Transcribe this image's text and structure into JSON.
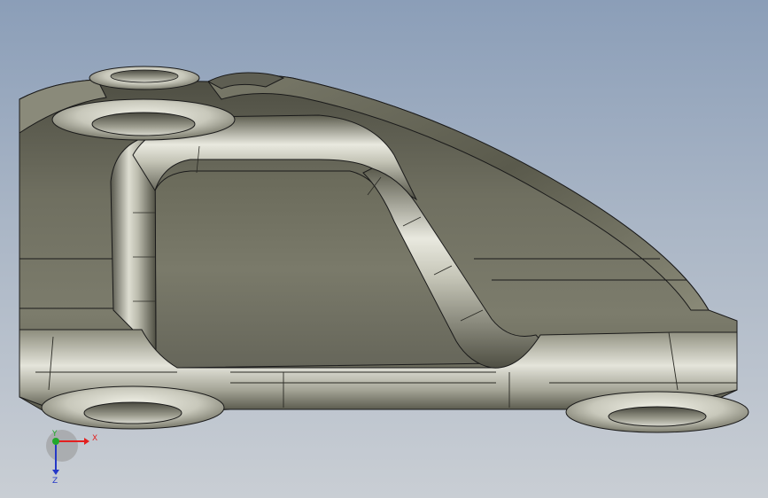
{
  "viewport": {
    "background_top": "#8b9eb8",
    "background_bottom": "#c9ced4",
    "model": {
      "body_color": "#6e6e5e",
      "highlight_color": "#e6e6dc",
      "edge_color": "#1a1a1a"
    }
  },
  "triad": {
    "x_label": "X",
    "y_label": "Y",
    "z_label": "Z",
    "x_color": "#e32020",
    "y_color": "#21a82b",
    "z_color": "#2438c7",
    "icons": [
      "x-axis-arrow-icon",
      "y-axis-arrow-icon",
      "z-axis-arrow-icon"
    ]
  }
}
